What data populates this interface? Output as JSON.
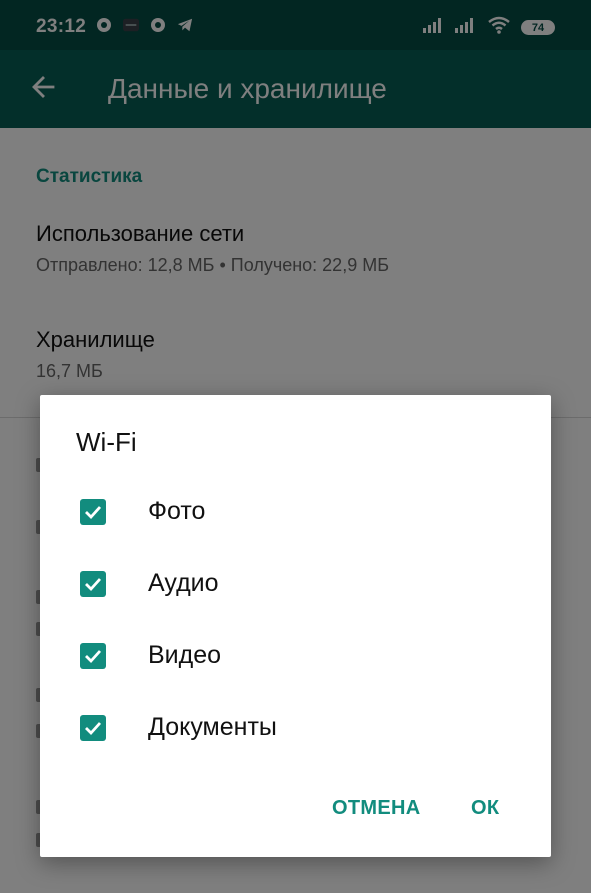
{
  "status_bar": {
    "time": "23:12",
    "battery": "74",
    "icons": [
      "chrome-icon",
      "app-icon",
      "chrome-icon",
      "telegram-icon",
      "signal-icon",
      "signal-icon",
      "wifi-icon",
      "battery-icon"
    ]
  },
  "app_bar": {
    "title": "Данные и хранилище",
    "back_icon": "arrow-left-icon"
  },
  "content": {
    "section_statistics": "Статистика",
    "network_usage": {
      "title": "Использование сети",
      "subtitle": "Отправлено: 12,8 МБ • Получено: 22,9 МБ"
    },
    "storage": {
      "title": "Хранилище",
      "subtitle": "16,7 МБ"
    }
  },
  "dialog": {
    "title": "Wi-Fi",
    "options": [
      {
        "label": "Фото",
        "checked": true
      },
      {
        "label": "Аудио",
        "checked": true
      },
      {
        "label": "Видео",
        "checked": true
      },
      {
        "label": "Документы",
        "checked": true
      }
    ],
    "cancel": "ОТМЕНА",
    "ok": "ОК"
  },
  "colors": {
    "status_bar": "#054d44",
    "app_bar": "#075e54",
    "accent": "#128c7e"
  }
}
